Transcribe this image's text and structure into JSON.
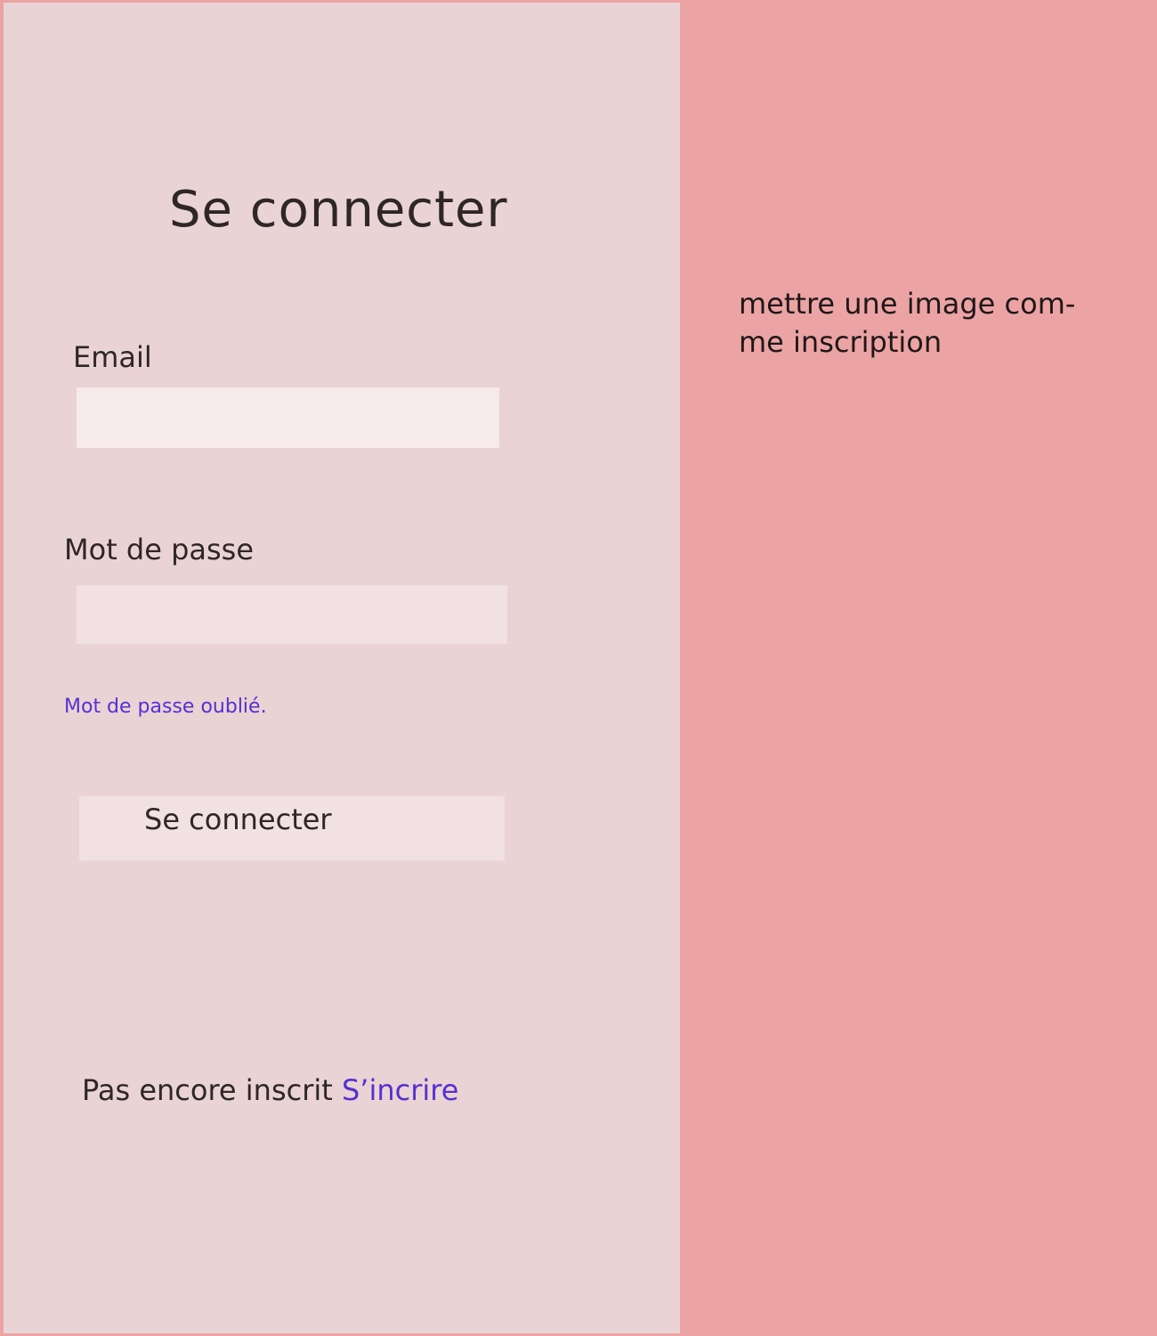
{
  "login": {
    "title": "Se connecter",
    "email_label": "Email",
    "email_value": "",
    "password_label": "Mot de passe",
    "password_value": "",
    "forgot_link": "Mot de passe oublié.",
    "submit_label": "Se connecter",
    "signup_prompt": "Pas encore inscrit ",
    "signup_link": "S’incrire"
  },
  "side_panel": {
    "note": "mettre une image com-\nme inscription"
  },
  "colors": {
    "page_background": "#eca3a4",
    "form_panel": "#e9d3d4",
    "input_background": "#f6eaea",
    "link": "#5531d0",
    "text": "#2e2627"
  }
}
